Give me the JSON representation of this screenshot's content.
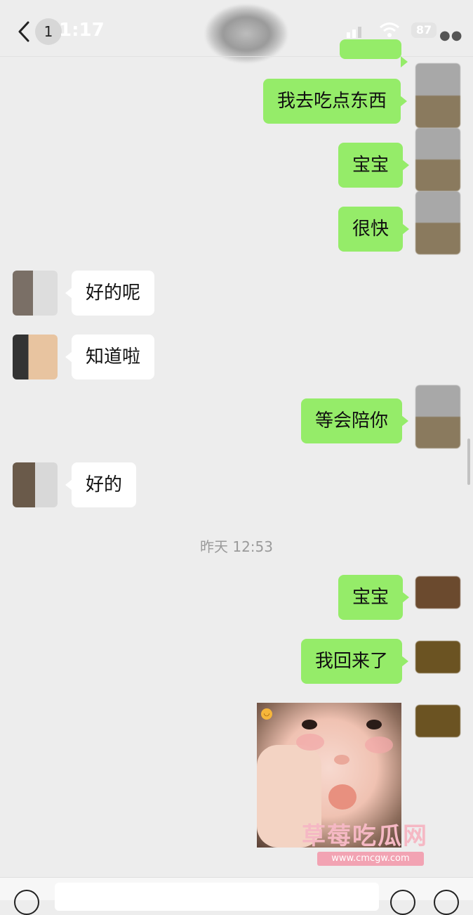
{
  "status_bar": {
    "time": "1:17",
    "unread_count": "1",
    "battery": "87"
  },
  "messages": [
    {
      "side": "out",
      "text": "我去吃点东西"
    },
    {
      "side": "out",
      "text": "宝宝"
    },
    {
      "side": "out",
      "text": "很快"
    },
    {
      "side": "in",
      "text": "好的呢"
    },
    {
      "side": "in",
      "text": "知道啦"
    },
    {
      "side": "out",
      "text": "等会陪你"
    },
    {
      "side": "in",
      "text": "好的"
    },
    {
      "side": "out",
      "text": "宝宝"
    },
    {
      "side": "out",
      "text": "我回来了"
    }
  ],
  "timestamp": "昨天 12:53",
  "watermark": {
    "title": "草莓吃瓜网",
    "url": "www.cmcgw.com"
  },
  "icons": {
    "back": "chevron-left-icon",
    "more": "more-dots-icon",
    "signal": "signal-icon",
    "wifi": "wifi-icon",
    "voice": "voice-icon",
    "emoji": "emoji-icon",
    "plus": "plus-icon"
  },
  "colors": {
    "outgoing_bubble": "#95ec69",
    "incoming_bubble": "#ffffff",
    "background": "#ededed"
  }
}
